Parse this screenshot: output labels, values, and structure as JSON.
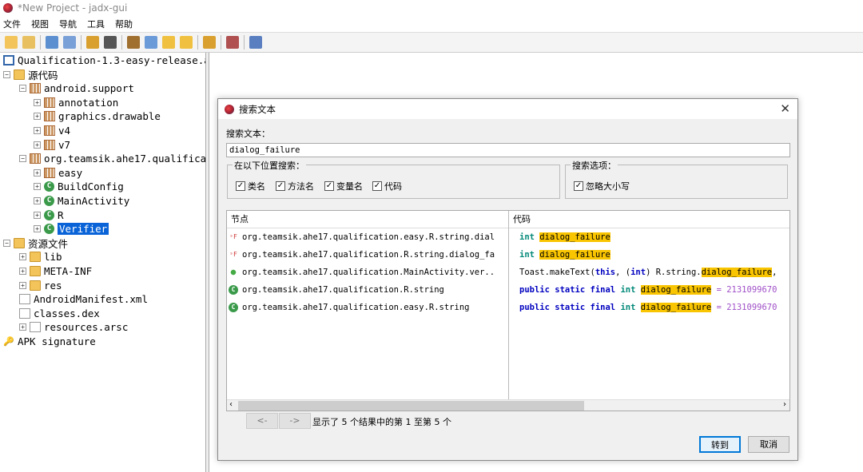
{
  "window": {
    "title": "*New Project - jadx-gui"
  },
  "menu": [
    "文件",
    "视图",
    "导航",
    "工具",
    "帮助"
  ],
  "toolbar_icons": [
    "open-file-icon",
    "add-file-icon",
    "save-all-icon",
    "export-icon",
    "sync-icon",
    "flatten-icon",
    "decompile-icon",
    "search-icon",
    "back-icon",
    "forward-icon",
    "deobfuscation-icon",
    "log-icon",
    "preferences-icon"
  ],
  "tree": [
    {
      "label": "Qualification-1.3-easy-release.a",
      "icon": "apk",
      "level": 0,
      "exp": ""
    },
    {
      "label": "源代码",
      "icon": "folder",
      "level": 0,
      "exp": "-"
    },
    {
      "label": "android.support",
      "icon": "package",
      "level": 1,
      "exp": "-"
    },
    {
      "label": "annotation",
      "icon": "package",
      "level": 2,
      "exp": "+"
    },
    {
      "label": "graphics.drawable",
      "icon": "package",
      "level": 2,
      "exp": "+"
    },
    {
      "label": "v4",
      "icon": "package",
      "level": 2,
      "exp": "+"
    },
    {
      "label": "v7",
      "icon": "package",
      "level": 2,
      "exp": "+"
    },
    {
      "label": "org.teamsik.ahe17.qualificat",
      "icon": "package",
      "level": 1,
      "exp": "-"
    },
    {
      "label": "easy",
      "icon": "package",
      "level": 2,
      "exp": "+"
    },
    {
      "label": "BuildConfig",
      "icon": "class",
      "level": 2,
      "exp": "+"
    },
    {
      "label": "MainActivity",
      "icon": "class",
      "level": 2,
      "exp": "+"
    },
    {
      "label": "R",
      "icon": "class",
      "level": 2,
      "exp": "+"
    },
    {
      "label": "Verifier",
      "icon": "class",
      "level": 2,
      "exp": "+",
      "selected": true
    },
    {
      "label": "资源文件",
      "icon": "folder",
      "level": 0,
      "exp": "-"
    },
    {
      "label": "lib",
      "icon": "folder",
      "level": 1,
      "exp": "+"
    },
    {
      "label": "META-INF",
      "icon": "folder",
      "level": 1,
      "exp": "+"
    },
    {
      "label": "res",
      "icon": "folder",
      "level": 1,
      "exp": "+"
    },
    {
      "label": "AndroidManifest.xml",
      "icon": "file",
      "level": 1,
      "exp": ""
    },
    {
      "label": "classes.dex",
      "icon": "file",
      "level": 1,
      "exp": ""
    },
    {
      "label": "resources.arsc",
      "icon": "file",
      "level": 1,
      "exp": "+"
    },
    {
      "label": "APK signature",
      "icon": "key",
      "level": 0,
      "exp": ""
    }
  ],
  "dialog": {
    "title": "搜索文本",
    "search_label": "搜索文本：",
    "search_value": "dialog_failure",
    "search_in": {
      "label": "在以下位置搜索：",
      "options": [
        {
          "label": "类名",
          "checked": true
        },
        {
          "label": "方法名",
          "checked": true
        },
        {
          "label": "变量名",
          "checked": true
        },
        {
          "label": "代码",
          "checked": true
        }
      ]
    },
    "search_options": {
      "label": "搜索选项：",
      "options": [
        {
          "label": "忽略大小写",
          "checked": true
        }
      ]
    },
    "columns": {
      "node": "节点",
      "code": "代码"
    },
    "results": [
      {
        "node": "org.teamsik.ahe17.qualification.easy.R.string.dial",
        "icon": "field",
        "code": [
          [
            "ty",
            "int "
          ],
          [
            "hl",
            "dialog_failure"
          ]
        ]
      },
      {
        "node": "org.teamsik.ahe17.qualification.R.string.dialog_fa",
        "icon": "field",
        "code": [
          [
            "ty",
            "int "
          ],
          [
            "hl",
            "dialog_failure"
          ]
        ]
      },
      {
        "node": "org.teamsik.ahe17.qualification.MainActivity.ver..",
        "icon": "method",
        "code": [
          [
            "",
            "Toast.makeText("
          ],
          [
            "kw",
            "this"
          ],
          [
            "",
            ", ("
          ],
          [
            "kw",
            "int"
          ],
          [
            "",
            ") R.string."
          ],
          [
            "hl",
            "dialog_failure"
          ],
          [
            "",
            ","
          ]
        ]
      },
      {
        "node": "org.teamsik.ahe17.qualification.R.string",
        "icon": "class",
        "code": [
          [
            "kw",
            "public static final "
          ],
          [
            "ty",
            "int "
          ],
          [
            "hl",
            "dialog_failure"
          ],
          [
            "num",
            " = 2131099670"
          ]
        ]
      },
      {
        "node": "org.teamsik.ahe17.qualification.easy.R.string",
        "icon": "class",
        "code": [
          [
            "kw",
            "public static final "
          ],
          [
            "ty",
            "int "
          ],
          [
            "hl",
            "dialog_failure"
          ],
          [
            "num",
            " = 2131099670"
          ]
        ]
      }
    ],
    "prev": "<-",
    "next": "->",
    "status": "显示了 5 个结果中的第 1 至第 5 个",
    "goto": "转到",
    "cancel": "取消"
  }
}
